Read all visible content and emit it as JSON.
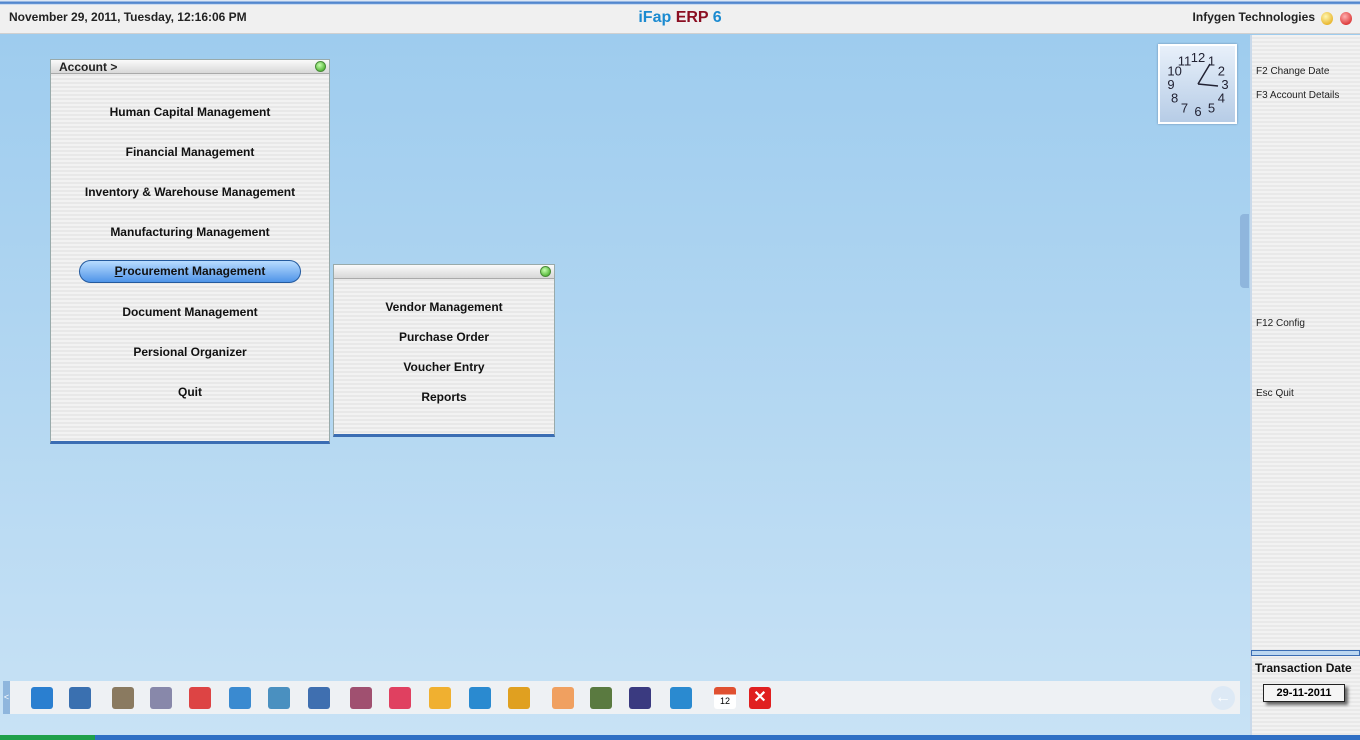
{
  "header": {
    "datetime": "November  29, 2011, Tuesday, 12:16:06 PM",
    "title_app": "iFap",
    "title_erp": "ERP",
    "title_ver": "6",
    "company": "Infygen Technologies"
  },
  "main_menu": {
    "title": "Account >",
    "items": [
      "Human Capital Management",
      "Financial Management",
      "Inventory & Warehouse Management",
      "Manufacturing Management",
      "Procurement Management",
      "Document Management",
      "Persional Organizer",
      "Quit"
    ],
    "selected": "Procurement Management"
  },
  "sub_menu": {
    "items": [
      "Vendor Management",
      "Purchase Order",
      "Voucher Entry",
      "Reports"
    ]
  },
  "sidebar": {
    "keys": [
      "F2 Change Date",
      "F3 Account Details",
      "F12 Config",
      "Esc Quit"
    ]
  },
  "transaction": {
    "label": "Transaction Date",
    "value": "29-11-2011"
  },
  "clock": {
    "numerals": [
      "12",
      "1",
      "2",
      "3",
      "4",
      "5",
      "6",
      "7",
      "8",
      "9",
      "10",
      "11"
    ]
  },
  "toolbar": {
    "icons": [
      "home-icon",
      "user-icon",
      "users-icon",
      "network-icon",
      "cabinet-icon",
      "cart-icon",
      "refresh-icon",
      "window-icon",
      "document-icon",
      "chart-icon",
      "folder-tree-icon",
      "share-icon",
      "package-icon",
      "compass-icon",
      "spreadsheet-icon",
      "save-icon",
      "settings-icon",
      "calendar-icon",
      "close-icon"
    ],
    "calendar_day": "12"
  },
  "colors": {
    "accent": "#1a8ad0",
    "erp": "#8b0f22",
    "selected": "#4f94e8"
  }
}
